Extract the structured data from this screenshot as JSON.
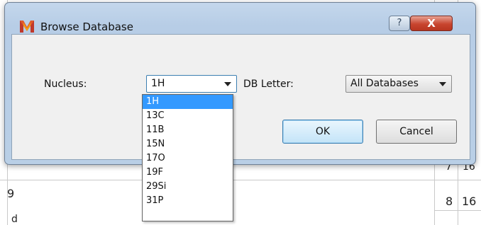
{
  "background": {
    "row_label": "9",
    "right_cells": [
      "7",
      "16",
      "8",
      "16"
    ],
    "partial_text": "d"
  },
  "dialog": {
    "title": "Browse Database",
    "help_label": "?",
    "close_label": "X",
    "nucleus_label": "Nucleus:",
    "nucleus_value": "1H",
    "db_letter_label": "DB Letter:",
    "db_letter_value": "All Databases",
    "ok_label": "OK",
    "cancel_label": "Cancel"
  },
  "dropdown": {
    "items": [
      "1H",
      "13C",
      "11B",
      "15N",
      "17O",
      "19F",
      "29Si",
      "31P"
    ],
    "selected_index": 0
  },
  "colors": {
    "selection": "#3399ff",
    "title_gradient": "#c4d7ec",
    "close_button": "#c8452f"
  }
}
